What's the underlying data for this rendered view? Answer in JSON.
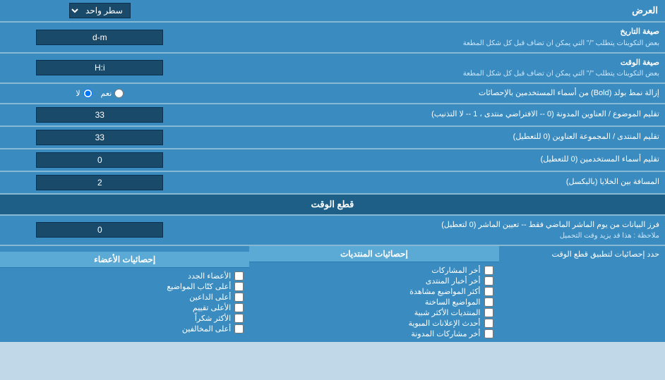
{
  "header": {
    "label": "العرض",
    "select_label": "سطر واحد"
  },
  "date_format": {
    "label": "صيغة التاريخ",
    "sublabel": "بعض التكوينات يتطلب \"/\" التي يمكن ان تضاف قبل كل شكل المطعة",
    "value": "d-m"
  },
  "time_format": {
    "label": "صيغة الوقت",
    "sublabel": "بعض التكوينات يتطلب \"/\" التي يمكن ان تضاف قبل كل شكل المطعة",
    "value": "H:i"
  },
  "bold_remove": {
    "label": "إزالة نمط بولد (Bold) من أسماء المستخدمين بالإحصائات",
    "option_yes": "نعم",
    "option_no": "لا",
    "selected": "no"
  },
  "topics_per_page": {
    "label": "تقليم الموضوع / العناوين المدونة (0 -- الافتراضي منتدى ، 1 -- لا التذنيب)",
    "value": "33"
  },
  "forums_per_group": {
    "label": "تقليم المنتدى / المجموعة العناوين (0 للتعطيل)",
    "value": "33"
  },
  "usernames_trim": {
    "label": "تقليم أسماء المستخدمين (0 للتعطيل)",
    "value": "0"
  },
  "cell_spacing": {
    "label": "المسافة بين الخلايا (بالبكسل)",
    "value": "2"
  },
  "cutoff_section": {
    "header": "قطع الوقت",
    "filter_label": "فرز البيانات من يوم الماشر الماضي فقط -- تعيين الماشر (0 لتعطيل)",
    "filter_note": "ملاحظة : هذا قد يزيد وقت التحميل",
    "filter_value": "0"
  },
  "stats_section": {
    "apply_label": "حدد إحصائيات لتطبيق قطع الوقت",
    "col1_header": "إحصائيات المنتديات",
    "col2_header": "إحصائيات الأعضاء",
    "col1_items": [
      "أخر المشاركات",
      "أخر أخبار المنتدى",
      "أكثر المواضيع مشاهدة",
      "المواضيع الساخنة",
      "المنتديات الأكثر شبية",
      "أحدث الإعلانات المبوية",
      "أخر مشاركات المدونة"
    ],
    "col2_items": [
      "الأعضاء الجدد",
      "أعلى كتّاب المواضيع",
      "أعلى الداعين",
      "الأعلى تقييم",
      "الأكثر شكراً",
      "أعلى المخالفين"
    ]
  }
}
